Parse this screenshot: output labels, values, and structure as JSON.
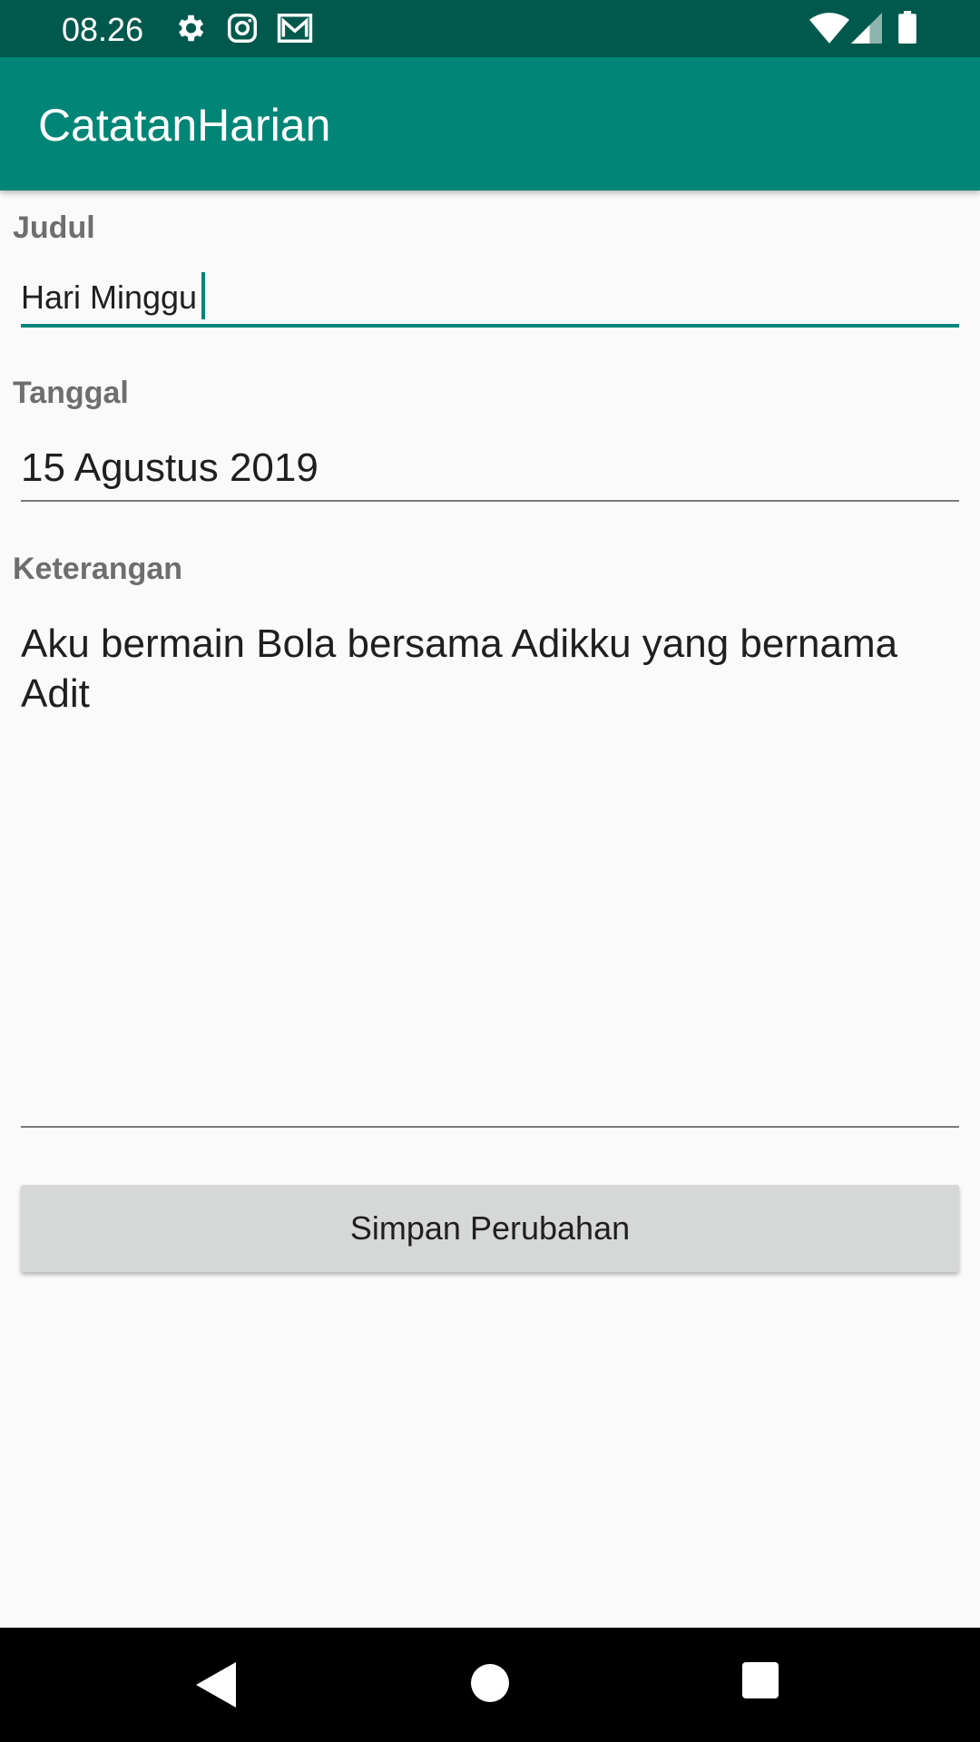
{
  "status_bar": {
    "time": "08.26",
    "left_icons": [
      "gear-icon",
      "instagram-icon",
      "gmail-icon"
    ],
    "right_icons": [
      "wifi-icon",
      "cellular-signal-icon",
      "battery-icon"
    ]
  },
  "app_bar": {
    "title": "CatatanHarian",
    "color": "#008577",
    "status_color": "#00594c"
  },
  "form": {
    "judul": {
      "label": "Judul",
      "value": "Hari Minggu",
      "focused": true
    },
    "tanggal": {
      "label": "Tanggal",
      "value": "15 Agustus 2019"
    },
    "keterangan": {
      "label": "Keterangan",
      "value": "Aku bermain Bola bersama Adikku yang bernama Adit"
    }
  },
  "actions": {
    "save_label": "Simpan Perubahan"
  },
  "nav_bar": {
    "buttons": [
      "back-icon",
      "home-icon",
      "recents-icon"
    ]
  }
}
